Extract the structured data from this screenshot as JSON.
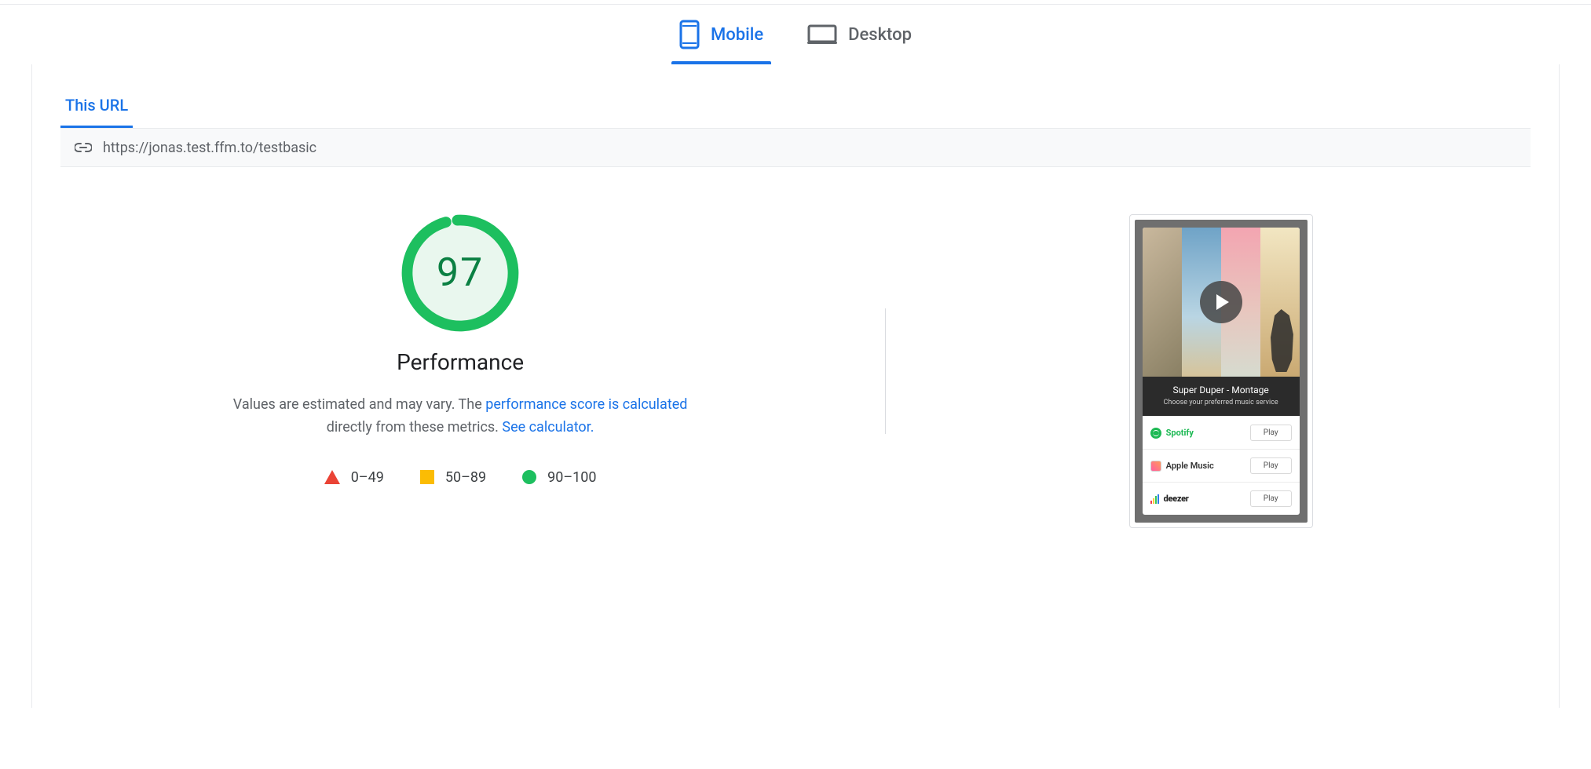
{
  "tabs": {
    "mobile_label": "Mobile",
    "desktop_label": "Desktop",
    "active": "mobile"
  },
  "sub_tabs": {
    "this_url_label": "This URL"
  },
  "url_bar": {
    "url": "https://jonas.test.ffm.to/testbasic"
  },
  "score": {
    "value": "97",
    "title": "Performance",
    "desc_prefix": "Values are estimated and may vary. The ",
    "desc_link1": "performance score is calculated",
    "desc_mid": " directly from these metrics. ",
    "desc_link2": "See calculator.",
    "color": "#1dbf5f",
    "fill": "#e9f7ee"
  },
  "legend": {
    "low": "0–49",
    "mid": "50–89",
    "high": "90–100"
  },
  "preview": {
    "track_title": "Super Duper - Montage",
    "track_sub": "Choose your preferred music service",
    "services": [
      {
        "name": "Spotify",
        "cta": "Play"
      },
      {
        "name": "Apple Music",
        "cta": "Play"
      },
      {
        "name": "deezer",
        "cta": "Play"
      }
    ]
  }
}
